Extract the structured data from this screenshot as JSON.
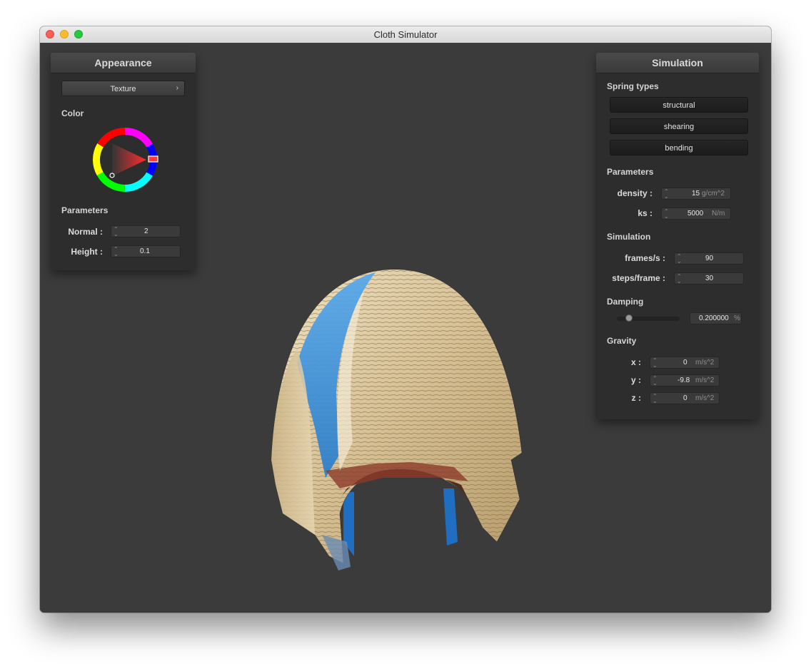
{
  "window": {
    "title": "Cloth Simulator"
  },
  "appearance": {
    "title": "Appearance",
    "shader_select": "Texture",
    "color_label": "Color",
    "parameters_label": "Parameters",
    "normal": {
      "label": "Normal :",
      "value": "2"
    },
    "height": {
      "label": "Height :",
      "value": "0.1"
    },
    "color_wheel": {
      "selected_hue_color": "#ff0000"
    }
  },
  "simulation": {
    "title": "Simulation",
    "spring_types_label": "Spring types",
    "springs": [
      "structural",
      "shearing",
      "bending"
    ],
    "parameters_label": "Parameters",
    "density": {
      "label": "density :",
      "value": "15",
      "unit": "g/cm^2"
    },
    "ks": {
      "label": "ks :",
      "value": "5000",
      "unit": "N/m"
    },
    "simulation_label": "Simulation",
    "fps": {
      "label": "frames/s :",
      "value": "90"
    },
    "steps": {
      "label": "steps/frame :",
      "value": "30"
    },
    "damping_label": "Damping",
    "damping": {
      "value": "0.200000",
      "unit": "%",
      "slider_fraction": 0.2
    },
    "gravity_label": "Gravity",
    "gravity": [
      {
        "label": "x :",
        "value": "0",
        "unit": "m/s^2"
      },
      {
        "label": "y :",
        "value": "-9.8",
        "unit": "m/s^2"
      },
      {
        "label": "z :",
        "value": "0",
        "unit": "m/s^2"
      }
    ]
  },
  "colors": {
    "viewport_bg": "#3b3b3b",
    "panel_bg": "#2d2d2d",
    "cloth_sky": "#4a9de0",
    "cloth_sand": "#d8c49a"
  }
}
